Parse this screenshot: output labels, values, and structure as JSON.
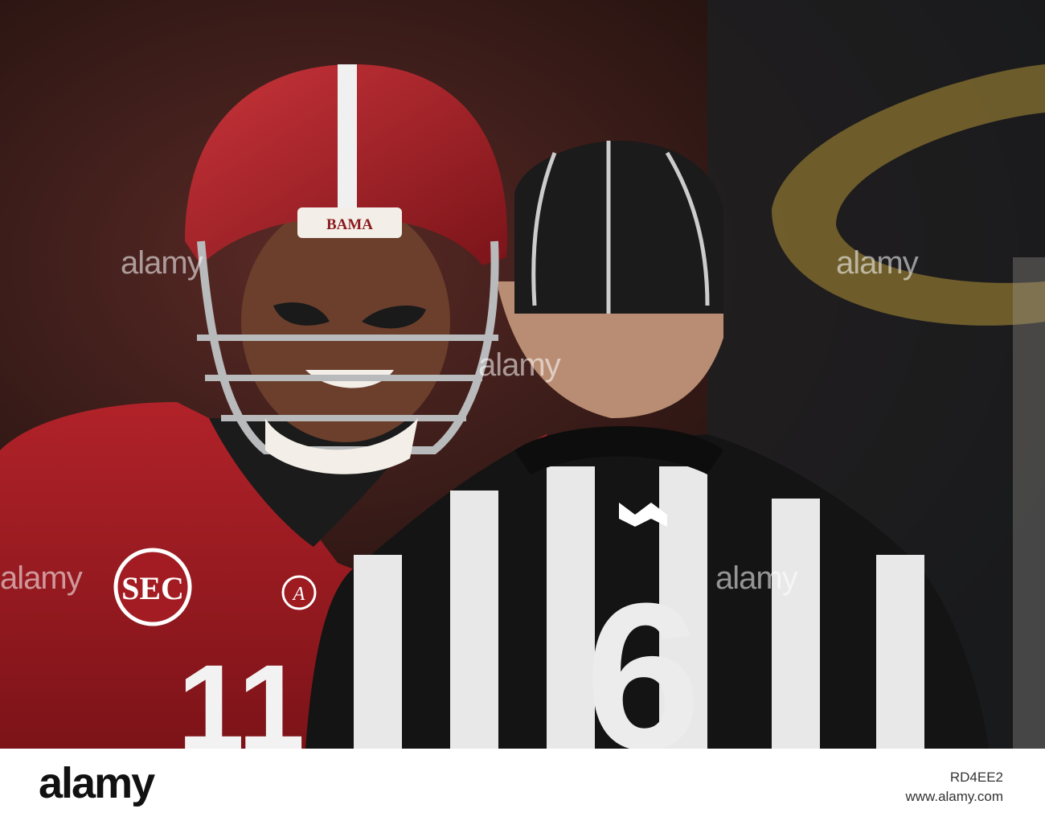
{
  "photo": {
    "helmet_text": "BAMA",
    "patch_text": "SEC",
    "jersey_number": "11",
    "referee_number": "6"
  },
  "watermark": {
    "text": "alamy"
  },
  "footer": {
    "logo": "alamy",
    "image_id": "RD4EE2",
    "url": "www.alamy.com"
  },
  "colors": {
    "crimson": "#9e1b20",
    "helmet_red": "#a11c24",
    "referee_black": "#141414",
    "stripe_white": "#e8e8e8"
  }
}
